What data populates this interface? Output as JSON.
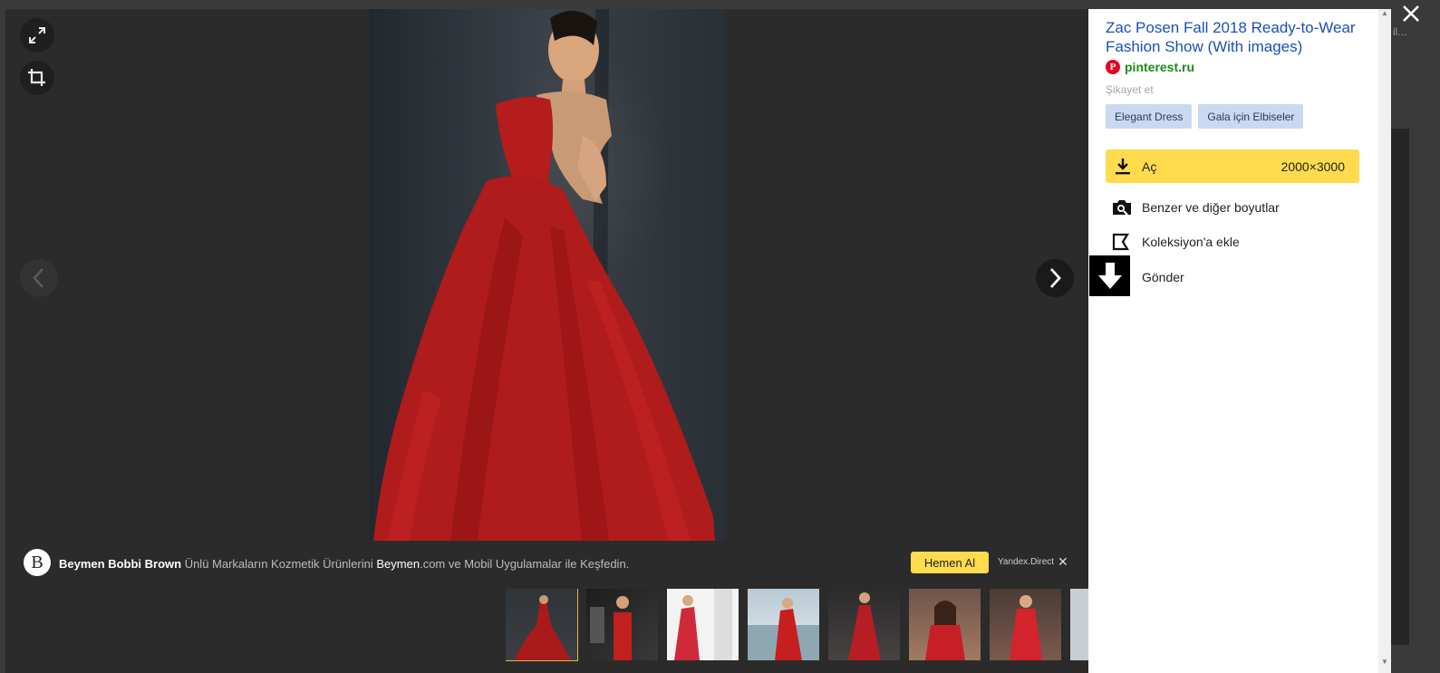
{
  "panel": {
    "title": "Zac Posen Fall 2018 Ready-to-Wear Fashion Show (With images)",
    "source_domain": "pinterest.ru",
    "report_label": "Şikayet et",
    "tags": [
      "Elegant Dress",
      "Gala için Elbiseler"
    ],
    "open_label": "Aç",
    "open_size": "2000×3000",
    "actions": {
      "similar": "Benzer ve diğer boyutlar",
      "collection": "Koleksiyon'a ekle",
      "send": "Gönder"
    }
  },
  "ad": {
    "logo_letter": "B",
    "brand": "Beymen Bobbi Brown",
    "text_before": " Ünlü Markaların Kozmetik Ürünlerini ",
    "highlight": "Beymen",
    "text_after": ".com ve Mobil Uygulamalar ile Keşfedin.",
    "cta": "Hemen Al",
    "source": "Yandex.Direct"
  },
  "behind": {
    "fragment": "il..."
  },
  "colors": {
    "accent": "#ffdb4d",
    "link": "#1a4fb9",
    "domain": "#1b8b1b",
    "tag_bg": "#c9d9f2",
    "viewer_bg": "#2b2b2b",
    "dress_red": "#b51c1c"
  },
  "icons": {
    "expand": "expand-icon",
    "crop": "crop-icon",
    "prev": "chevron-left-icon",
    "next": "chevron-right-icon",
    "download": "download-icon",
    "camera": "camera-search-icon",
    "bookmark": "bookmark-icon",
    "close": "close-icon"
  }
}
